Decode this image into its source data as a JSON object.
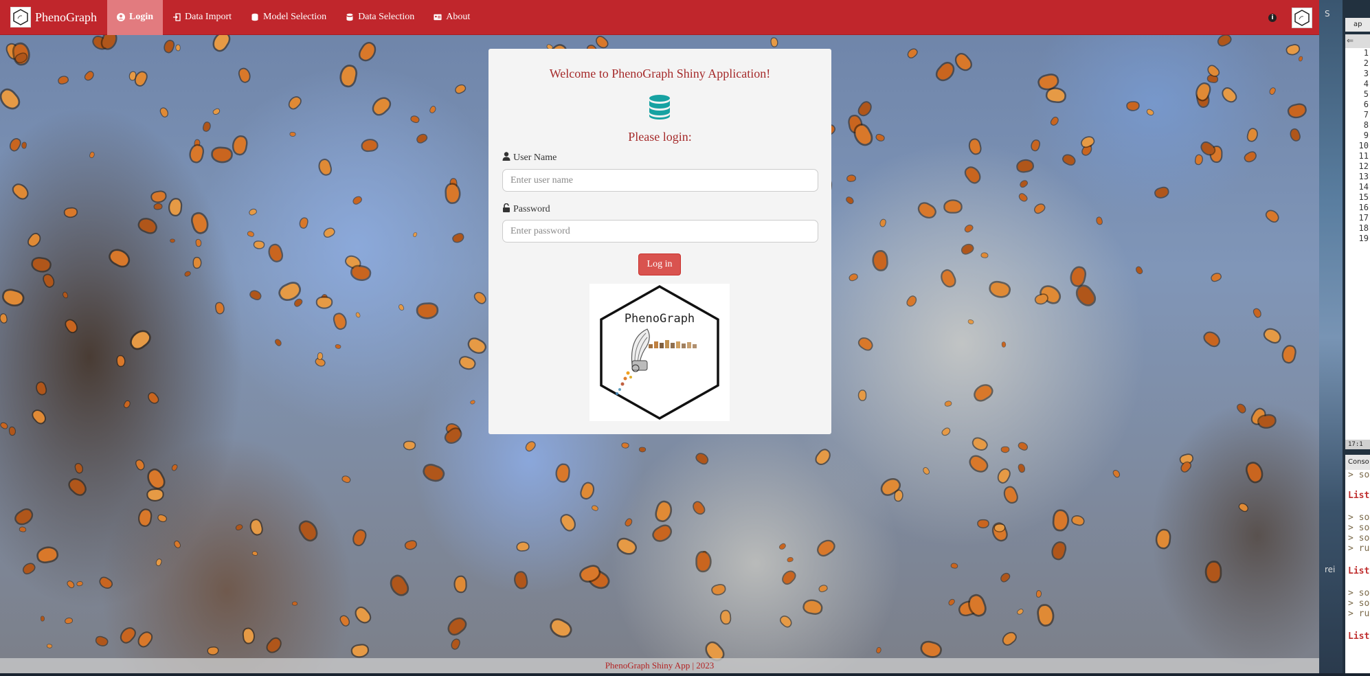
{
  "navbar": {
    "brand": "PhenoGraph",
    "items": [
      {
        "label": "Login",
        "icon": "user-circle-icon",
        "active": true
      },
      {
        "label": "Data Import",
        "icon": "sign-in-icon",
        "active": false
      },
      {
        "label": "Model Selection",
        "icon": "hexagon-icon",
        "active": false
      },
      {
        "label": "Data Selection",
        "icon": "database-icon",
        "active": false
      },
      {
        "label": "About",
        "icon": "id-card-icon",
        "active": false
      }
    ],
    "right_icons": [
      "info-icon",
      "phenograph-logo"
    ]
  },
  "login": {
    "welcome": "Welcome to PhenoGraph Shiny Application!",
    "prompt": "Please login:",
    "username_label": "User Name",
    "username_placeholder": "Enter user name",
    "password_label": "Password",
    "password_placeholder": "Enter password",
    "button": "Log in",
    "logo_text": "PhenoGraph"
  },
  "footer": "PhenoGraph Shiny App | 2023",
  "ide": {
    "tab": "ap",
    "line_numbers": [
      "1",
      "2",
      "3",
      "4",
      "5",
      "6",
      "7",
      "8",
      "9",
      "10",
      "11",
      "12",
      "13",
      "14",
      "15",
      "16",
      "17",
      "18",
      "19"
    ],
    "cursor_pos": "17:1",
    "console_header": "Conso",
    "side_text_1": "S",
    "side_text_2": "rei",
    "console_lines": [
      {
        "text": "> so",
        "kind": "cmd"
      },
      {
        "text": "List",
        "kind": "list"
      },
      {
        "text": "> so",
        "kind": "cmd"
      },
      {
        "text": "> so",
        "kind": "cmd"
      },
      {
        "text": "> so",
        "kind": "cmd"
      },
      {
        "text": "> ru",
        "kind": "cmd"
      },
      {
        "text": "List",
        "kind": "list"
      },
      {
        "text": "> so",
        "kind": "cmd"
      },
      {
        "text": "> so",
        "kind": "cmd"
      },
      {
        "text": "> ru",
        "kind": "cmd"
      },
      {
        "text": "List",
        "kind": "list"
      }
    ]
  },
  "colors": {
    "navbar": "#c0262c",
    "active_tab": "#e27b7f",
    "heading": "#a52a2a",
    "button": "#d9534f",
    "db_icon": "#17a2a2"
  }
}
